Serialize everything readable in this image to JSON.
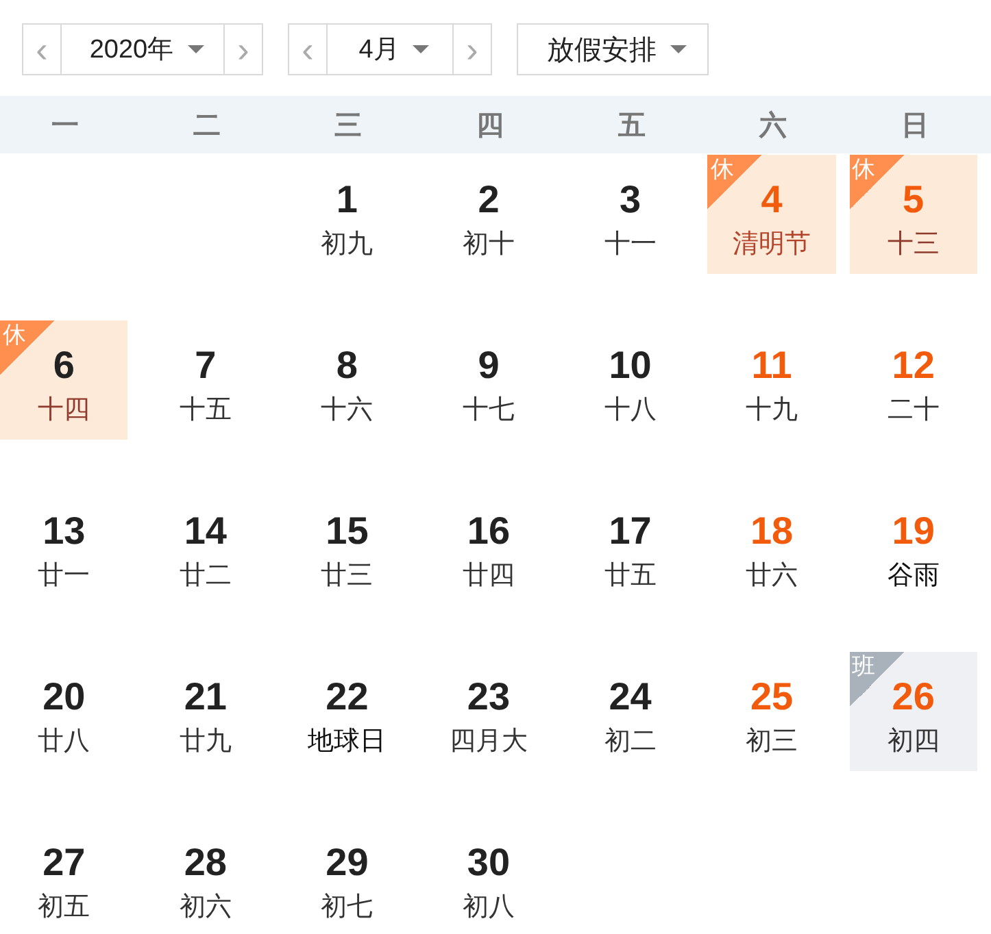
{
  "toolbar": {
    "year": {
      "value": "2020年",
      "prev": "‹",
      "next": "›"
    },
    "month": {
      "value": "4月",
      "prev": "‹",
      "next": "›"
    },
    "holiday": {
      "value": "放假安排"
    }
  },
  "weekdays": [
    "一",
    "二",
    "三",
    "四",
    "五",
    "六",
    "日"
  ],
  "weeks": [
    [
      {
        "kind": "blank"
      },
      {
        "kind": "blank"
      },
      {
        "kind": "day",
        "date": "1",
        "lunar": "初九",
        "weekend": false,
        "festival": false
      },
      {
        "kind": "day",
        "date": "2",
        "lunar": "初十",
        "weekend": false,
        "festival": false
      },
      {
        "kind": "day",
        "date": "3",
        "lunar": "十一",
        "weekend": false,
        "festival": false
      },
      {
        "kind": "day",
        "date": "4",
        "lunar": "清明节",
        "weekend": true,
        "festival": true,
        "badge": {
          "kind": "rest",
          "text": "休"
        }
      },
      {
        "kind": "day",
        "date": "5",
        "lunar": "十三",
        "weekend": true,
        "festival": false,
        "badge": {
          "kind": "rest",
          "text": "休"
        }
      }
    ],
    [
      {
        "kind": "day",
        "date": "6",
        "lunar": "十四",
        "weekend": false,
        "festival": false,
        "badge": {
          "kind": "rest",
          "text": "休"
        }
      },
      {
        "kind": "day",
        "date": "7",
        "lunar": "十五",
        "weekend": false,
        "festival": false
      },
      {
        "kind": "day",
        "date": "8",
        "lunar": "十六",
        "weekend": false,
        "festival": false
      },
      {
        "kind": "day",
        "date": "9",
        "lunar": "十七",
        "weekend": false,
        "festival": false
      },
      {
        "kind": "day",
        "date": "10",
        "lunar": "十八",
        "weekend": false,
        "festival": false
      },
      {
        "kind": "day",
        "date": "11",
        "lunar": "十九",
        "weekend": true,
        "festival": false
      },
      {
        "kind": "day",
        "date": "12",
        "lunar": "二十",
        "weekend": true,
        "festival": false
      }
    ],
    [
      {
        "kind": "day",
        "date": "13",
        "lunar": "廿一",
        "weekend": false,
        "festival": false
      },
      {
        "kind": "day",
        "date": "14",
        "lunar": "廿二",
        "weekend": false,
        "festival": false
      },
      {
        "kind": "day",
        "date": "15",
        "lunar": "廿三",
        "weekend": false,
        "festival": false
      },
      {
        "kind": "day",
        "date": "16",
        "lunar": "廿四",
        "weekend": false,
        "festival": false
      },
      {
        "kind": "day",
        "date": "17",
        "lunar": "廿五",
        "weekend": false,
        "festival": false
      },
      {
        "kind": "day",
        "date": "18",
        "lunar": "廿六",
        "weekend": true,
        "festival": false
      },
      {
        "kind": "day",
        "date": "19",
        "lunar": "谷雨",
        "weekend": true,
        "festival": true
      }
    ],
    [
      {
        "kind": "day",
        "date": "20",
        "lunar": "廿八",
        "weekend": false,
        "festival": false
      },
      {
        "kind": "day",
        "date": "21",
        "lunar": "廿九",
        "weekend": false,
        "festival": false
      },
      {
        "kind": "day",
        "date": "22",
        "lunar": "地球日",
        "weekend": false,
        "festival": true
      },
      {
        "kind": "day",
        "date": "23",
        "lunar": "四月大",
        "weekend": false,
        "festival": false
      },
      {
        "kind": "day",
        "date": "24",
        "lunar": "初二",
        "weekend": false,
        "festival": false
      },
      {
        "kind": "day",
        "date": "25",
        "lunar": "初三",
        "weekend": true,
        "festival": false
      },
      {
        "kind": "day",
        "date": "26",
        "lunar": "初四",
        "weekend": true,
        "festival": false,
        "badge": {
          "kind": "work",
          "text": "班"
        }
      }
    ],
    [
      {
        "kind": "day",
        "date": "27",
        "lunar": "初五",
        "weekend": false,
        "festival": false
      },
      {
        "kind": "day",
        "date": "28",
        "lunar": "初六",
        "weekend": false,
        "festival": false
      },
      {
        "kind": "day",
        "date": "29",
        "lunar": "初七",
        "weekend": false,
        "festival": false
      },
      {
        "kind": "day",
        "date": "30",
        "lunar": "初八",
        "weekend": false,
        "festival": false
      },
      {
        "kind": "blank"
      },
      {
        "kind": "blank"
      },
      {
        "kind": "blank"
      }
    ]
  ]
}
